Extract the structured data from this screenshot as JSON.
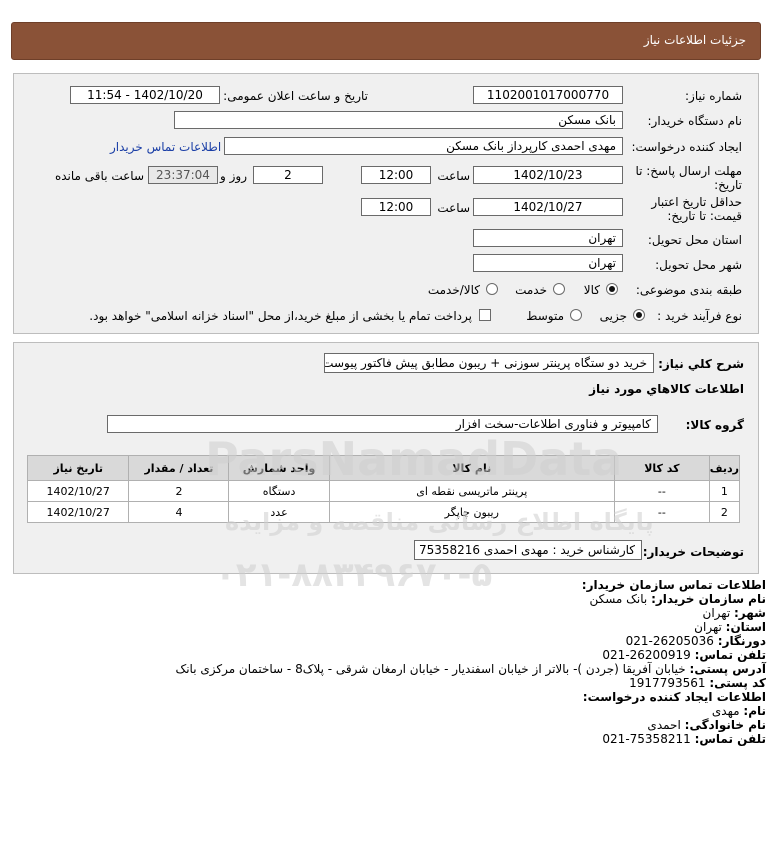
{
  "header": {
    "title": "جزئیات اطلاعات نیاز"
  },
  "form": {
    "need_number_label": "شماره نیاز:",
    "need_number": "1102001017000770",
    "announce_label": "تاریخ و ساعت اعلان عمومی:",
    "announce_value": "1402/10/20 - 11:54",
    "buyer_org_label": "نام دستگاه خریدار:",
    "buyer_org": "بانک مسکن",
    "creator_label": "ایجاد کننده درخواست:",
    "creator": "مهدی احمدی کارپرداز بانک مسکن",
    "contact_link": "اطلاعات تماس خریدار",
    "deadline_label_1": "مهلت ارسال پاسخ: تا",
    "deadline_label_2": "تاریخ:",
    "deadline_date": "1402/10/23",
    "time_label": "ساعت",
    "deadline_time": "12:00",
    "days_value": "2",
    "days_label": "روز و",
    "remaining_value": "23:37:04",
    "remaining_label": "ساعت باقی مانده",
    "validity_label_1": "حداقل تاریخ اعتبار",
    "validity_label_2": "قیمت: تا تاریخ:",
    "validity_date": "1402/10/27",
    "validity_time": "12:00",
    "province_label": "استان محل تحویل:",
    "province": "تهران",
    "city_label": "شهر محل تحویل:",
    "city": "تهران",
    "category_label": "طبقه بندی موضوعی:",
    "category_options": [
      "کالا",
      "خدمت",
      "کالا/خدمت"
    ],
    "process_label": "نوع فرآیند خرید :",
    "process_options": [
      "جزیی",
      "متوسط"
    ],
    "payment_note": "پرداخت تمام یا بخشی از مبلغ خرید،از محل \"اسناد خزانه اسلامی\" خواهد بود."
  },
  "details": {
    "summary_label": "شرح کلي نياز:",
    "summary": "خرید دو ستگاه پرینتر سوزنی + ریبون مطابق پیش فاکتور پیوست.",
    "goods_title": "اطلاعات کالاهاي مورد نياز",
    "group_label": "گروه کالا:",
    "group_value": "کامپیوتر و فناوری اطلاعات-سخت افزار",
    "table": {
      "headers": [
        "ردیف",
        "کد کالا",
        "نام کالا",
        "واحد شمارش",
        "تعداد / مقدار",
        "تاریخ نیاز"
      ],
      "rows": [
        [
          "1",
          "--",
          "پرینتر ماتریسی نقطه ای",
          "دستگاه",
          "2",
          "1402/10/27"
        ],
        [
          "2",
          "--",
          "ریبون چاپگر",
          "عدد",
          "4",
          "1402/10/27"
        ]
      ]
    },
    "buyer_notes_label": "توضیحات خریدار:",
    "buyer_notes": "کارشناس خرید : مهدی احمدی 75358216"
  },
  "contact": {
    "l1": "اطلاعات تماس سازمان خریدار:",
    "l2_label": "نام سازمان خریدار:",
    "l2_value": "بانک مسکن",
    "l3_label": "شهر:",
    "l3_value": "تهران",
    "l4_label": "استان:",
    "l4_value": "تهران",
    "l5_label": "دورنگار:",
    "l5_value": "26205036-021",
    "l6_label": "تلفن تماس:",
    "l6_value": "26200919-021",
    "l7_label": "آدرس پستی:",
    "l7_value": "خیابان آفریقا (جردن )- بالاتر از خیابان اسفندیار - خیابان ارمغان شرقی - پلاک8 - ساختمان مرکزی بانک",
    "l8_label": "کد پستی:",
    "l8_value": "1917793561",
    "l9": "اطلاعات ایجاد کننده درخواست:",
    "l10_label": "نام:",
    "l10_value": "مهدی",
    "l11_label": "نام خانوادگی:",
    "l11_value": "احمدی",
    "l12_label": "تلفن تماس:",
    "l12_value": "75358211-021"
  },
  "watermark": {
    "brand": "ParsNamadData",
    "tagline": "پایگاه اطلاع رسانی مناقصه و مزایده",
    "phone": "۰۲۱-۸۸۳۴۹۶۷۰-۵"
  }
}
